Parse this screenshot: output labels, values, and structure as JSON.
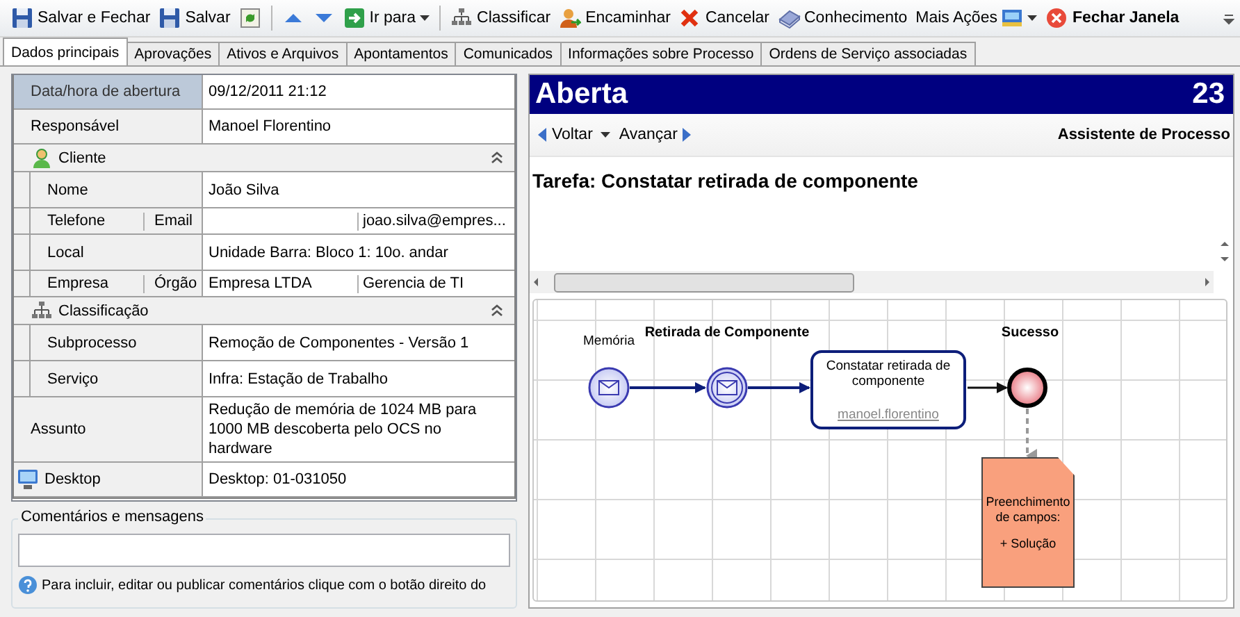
{
  "toolbar": [
    {
      "kind": "button",
      "label": "Salvar e Fechar"
    },
    {
      "kind": "button",
      "label": "Salvar"
    },
    {
      "kind": "icon"
    },
    {
      "kind": "separator"
    },
    {
      "kind": "icon"
    },
    {
      "kind": "icon"
    },
    {
      "kind": "dropdown",
      "label": "Ir para"
    },
    {
      "kind": "separator"
    },
    {
      "kind": "button",
      "label": "Classificar"
    },
    {
      "kind": "button",
      "label": "Encaminhar"
    },
    {
      "kind": "button",
      "label": "Cancelar"
    },
    {
      "kind": "button",
      "label": "Conhecimento"
    },
    {
      "kind": "menu",
      "label": "Mais Ações"
    },
    {
      "kind": "strong",
      "label": "Fechar Janela"
    }
  ],
  "tabs": [
    {
      "label": "Dados principais",
      "selected": true
    },
    {
      "label": "Aprovações",
      "selected": false
    },
    {
      "label": "Ativos e Arquivos",
      "selected": false
    },
    {
      "label": "Apontamentos",
      "selected": false
    },
    {
      "label": "Comunicados",
      "selected": false
    },
    {
      "label": "Informações sobre Processo",
      "selected": false
    },
    {
      "label": "Ordens de Serviço associadas",
      "selected": false
    }
  ],
  "properties": [
    {
      "kind": "field",
      "label": "Data/hora de abertura",
      "value": "09/12/2011 21:12",
      "selected": true
    },
    {
      "kind": "field",
      "label": "Responsável",
      "value": "Manoel Florentino",
      "selected": false
    },
    {
      "kind": "section",
      "label": "Cliente",
      "expanded": true,
      "children": [
        {
          "kind": "field",
          "label": "Nome",
          "value": "João Silva",
          "selected": false
        },
        {
          "kind": "split",
          "labels": [
            "Telefone",
            "Email"
          ],
          "right_value": "joao.silva@empres...",
          "selected": false
        },
        {
          "kind": "field",
          "label": "Local",
          "value": "Unidade Barra: Bloco 1: 10o. andar",
          "selected": false
        },
        {
          "kind": "split",
          "labels": [
            "Empresa",
            "Órgão"
          ],
          "left_value": "Empresa LTDA",
          "right_value": "Gerencia de TI",
          "selected": false
        }
      ]
    },
    {
      "kind": "section",
      "label": "Classificação",
      "expanded": true,
      "children": [
        {
          "kind": "field",
          "label": "Subprocesso",
          "value": "Remoção de Componentes - Versão 1",
          "selected": false
        },
        {
          "kind": "field",
          "label": "Serviço",
          "value": "Infra: Estação de Trabalho",
          "selected": false
        }
      ]
    },
    {
      "kind": "field",
      "label": "Assunto",
      "value": "Redução de memória de 1024 MB para 1000 MB descoberta pelo OCS no hardware",
      "selected": false
    },
    {
      "kind": "asset",
      "label": "Desktop",
      "value": "Desktop: 01-031050",
      "selected": false
    }
  ],
  "comments": {
    "legend": "Comentários e mensagens",
    "hint": "Para incluir, editar ou publicar comentários clique com o botão direito do"
  },
  "status": {
    "title": "Aberta",
    "number": "23"
  },
  "navigation": {
    "back": "Voltar",
    "forward": "Avançar",
    "title": "Assistente de Processo"
  },
  "task": {
    "title": "Tarefa: Constatar retirada de componente"
  },
  "diagram": {
    "start": {
      "label": "Memória"
    },
    "intermediate": {
      "label": "Retirada de Componente"
    },
    "task": {
      "label": "Constatar retirada de componente",
      "assignee": "manoel.florentino"
    },
    "end": {
      "label": "Sucesso"
    },
    "note": {
      "title": "Preenchimento de campos:",
      "item": "+ Solução"
    }
  }
}
